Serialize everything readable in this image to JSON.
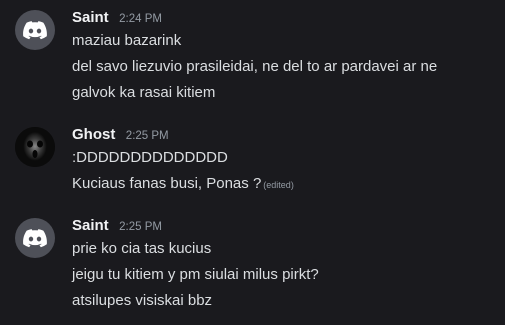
{
  "groups": [
    {
      "username": "Saint",
      "timestamp": "2:24 PM",
      "avatar": "discord-default-icon",
      "messages": [
        {
          "text": "maziau bazarink"
        },
        {
          "text": "del savo liezuvio prasileidai, ne del to ar pardavei ar ne"
        },
        {
          "text": "galvok ka rasai kitiem"
        }
      ]
    },
    {
      "username": "Ghost",
      "timestamp": "2:25 PM",
      "avatar": "ghost-face-avatar",
      "messages": [
        {
          "text": ":DDDDDDDDDDDDDD"
        },
        {
          "text": "Kuciaus fanas busi, Ponas ?",
          "edited": "(edited)"
        }
      ]
    },
    {
      "username": "Saint",
      "timestamp": "2:25 PM",
      "avatar": "discord-default-icon",
      "messages": [
        {
          "text": "prie ko cia tas kucius"
        },
        {
          "text": "jeigu tu kitiem y pm siulai milus pirkt?"
        },
        {
          "text": "atsilupes visiskai bbz"
        }
      ]
    }
  ],
  "colors": {
    "background": "#1a1a1e",
    "username": "#f2f3f5",
    "message": "#dbdee1",
    "timestamp": "#949ba4"
  }
}
